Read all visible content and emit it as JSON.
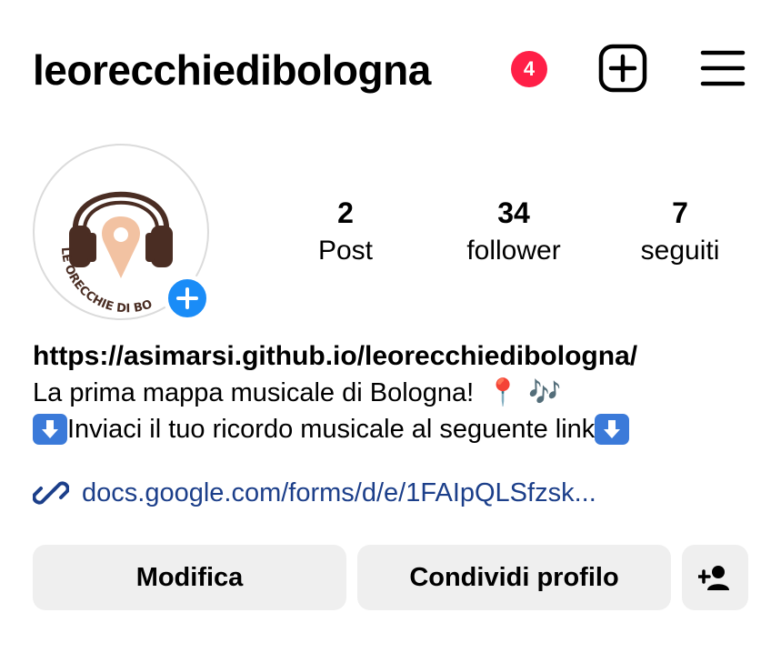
{
  "header": {
    "username": "leorecchiedibologna",
    "notification_count": "4",
    "new_post_icon": "plus-square-icon",
    "menu_icon": "hamburger-menu-icon"
  },
  "profile": {
    "avatar_text": "LE ORECCHIE DI BO",
    "add_story_icon": "plus-icon"
  },
  "stats": [
    {
      "value": "2",
      "label": "Post"
    },
    {
      "value": "34",
      "label": "follower"
    },
    {
      "value": "7",
      "label": "seguiti"
    }
  ],
  "bio": {
    "title": "https://asimarsi.github.io/leorecchiedibologna/",
    "line1_text": "La prima mappa musicale di Bologna!",
    "line1_pin_emoji": "📍",
    "line1_notes_emoji": "🎶",
    "line2_text": "Inviaci il tuo ricordo musicale al seguente link",
    "down_arrow_icon": "down-arrow-emoji-icon"
  },
  "link": {
    "text": "docs.google.com/forms/d/e/1FAIpQLSfzsk...",
    "icon": "link-icon"
  },
  "actions": {
    "edit_label": "Modifica",
    "share_label": "Condividi profilo",
    "add_person_icon": "add-person-icon"
  },
  "colors": {
    "badge": "#ff1f47",
    "story_button": "#1a8cf7",
    "link": "#1c3f8a",
    "button_bg": "#efefef",
    "avatar_pin": "#f2c2a2",
    "avatar_headphones": "#4a2d23"
  }
}
